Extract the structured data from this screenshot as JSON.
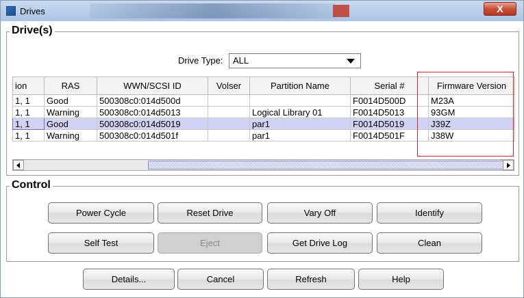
{
  "window": {
    "title": "Drives",
    "close_symbol": "X"
  },
  "drives_group": {
    "title": "Drive(s)",
    "drive_type_label": "Drive Type:",
    "drive_type_value": "ALL"
  },
  "table": {
    "columns": [
      "ion",
      "RAS",
      "WWN/SCSI ID",
      "Volser",
      "Partition Name",
      "Serial #",
      "Firmware Version"
    ],
    "rows": [
      [
        "1, 1",
        "Good",
        "500308c0:014d500d",
        "",
        "",
        "F0014D500D",
        "M23A"
      ],
      [
        "1, 1",
        "Warning",
        "500308c0:014d5013",
        "",
        "Logical Library 01",
        "F0014D5013",
        "93GM"
      ],
      [
        "1, 1",
        "Good",
        "500308c0:014d5019",
        "",
        "par1",
        "F0014D5019",
        "J39Z"
      ],
      [
        "1, 1",
        "Warning",
        "500308c0:014d501f",
        "",
        "par1",
        "F0014D501F",
        "J38W"
      ]
    ],
    "selected_row_index": 2
  },
  "control_group": {
    "title": "Control",
    "buttons": {
      "power_cycle": "Power Cycle",
      "reset_drive": "Reset Drive",
      "vary_off": "Vary Off",
      "identify": "Identify",
      "self_test": "Self Test",
      "eject": "Eject",
      "get_drive_log": "Get Drive Log",
      "clean": "Clean"
    }
  },
  "footer": {
    "details": "Details...",
    "cancel": "Cancel",
    "refresh": "Refresh",
    "help": "Help"
  },
  "colors": {
    "selected_row": "#d2d2f4",
    "highlight_border": "#d0222a",
    "titlebar": "#aac4e4"
  }
}
